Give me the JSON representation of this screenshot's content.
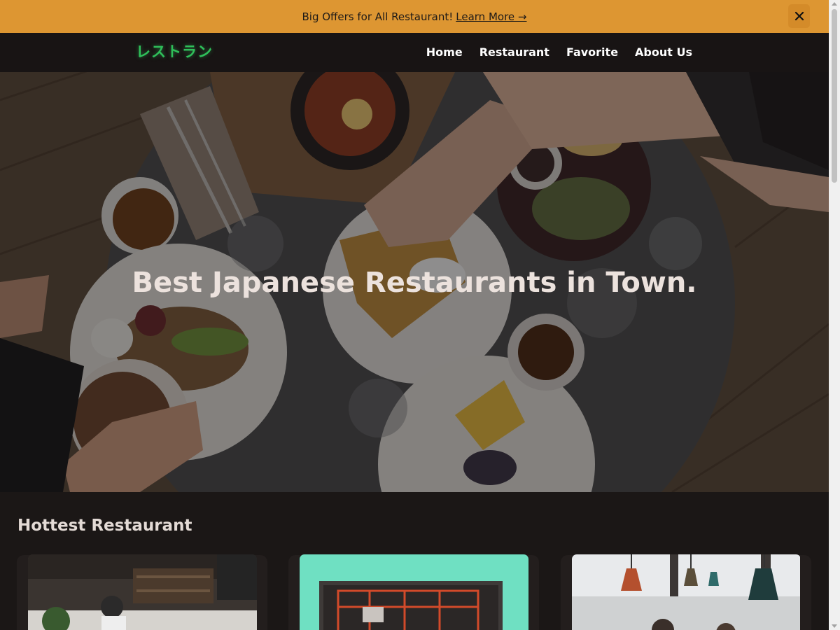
{
  "offer_bar": {
    "text": "Big Offers for All Restaurant!",
    "link_label": "Learn More →",
    "close_icon": "close-icon",
    "background": "#dd9632"
  },
  "navbar": {
    "brand": "レストラン",
    "brand_color": "#2fbf5a",
    "links": [
      "Home",
      "Restaurant",
      "Favorite",
      "About Us"
    ]
  },
  "hero": {
    "title": "Best Japanese Restaurants in Town."
  },
  "hottest": {
    "title": "Hottest Restaurant"
  }
}
